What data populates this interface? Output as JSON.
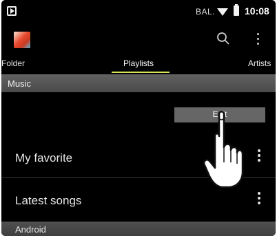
{
  "status_bar": {
    "carrier": "BAL.",
    "time": "10:08",
    "icons": [
      "cast-icon",
      "signal-icon",
      "battery-icon"
    ]
  },
  "app_bar": {
    "icons": [
      "app-logo",
      "search-icon",
      "more-icon"
    ]
  },
  "tabs": [
    {
      "label": "Folder",
      "selected": false
    },
    {
      "label": "Playlists",
      "selected": true
    },
    {
      "label": "Artists",
      "selected": false
    }
  ],
  "sections": [
    {
      "header": "Music",
      "items": [
        {
          "label": "My favorite"
        },
        {
          "label": "Latest songs"
        }
      ]
    },
    {
      "header": "Android"
    }
  ],
  "popup": {
    "edit_label": "Edit"
  },
  "colors": {
    "background": "#000000",
    "tab_indicator": "#d7e35a",
    "section_header": "#555555",
    "popup": "#666666"
  },
  "overlay": {
    "icon": "pointing-hand-icon"
  }
}
